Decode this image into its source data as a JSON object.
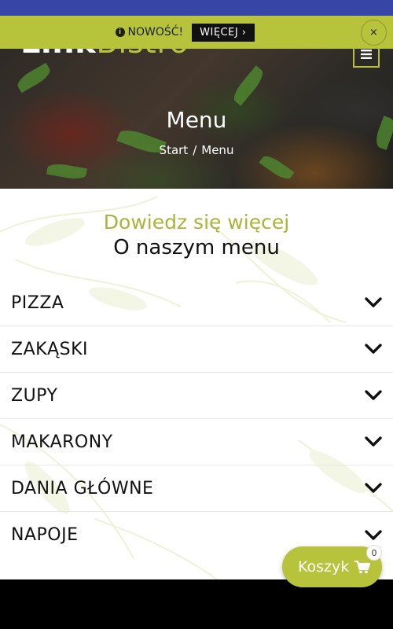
{
  "notice": {
    "text": "NOWOŚĆ!",
    "button_label": "WIĘCEJ ›",
    "close_label": "×"
  },
  "header": {
    "logo_part1": "Link",
    "logo_part2": "Bistro",
    "menu_icon": "hamburger-icon"
  },
  "hero": {
    "title": "Menu",
    "breadcrumb": {
      "home": "Start",
      "separator": "/",
      "current": "Menu"
    }
  },
  "main": {
    "eyebrow": "Dowiedz się więcej",
    "title": "O naszym menu",
    "categories": [
      {
        "label": "PIZZA"
      },
      {
        "label": "ZAKĄSKI"
      },
      {
        "label": "ZUPY"
      },
      {
        "label": "MAKARONY"
      },
      {
        "label": "DANIA GŁÓWNE"
      },
      {
        "label": "NAPOJE"
      }
    ]
  },
  "cart": {
    "label": "Koszyk",
    "count": "0",
    "icon": "cart-icon"
  },
  "colors": {
    "accent": "#b6c33b",
    "status_bar": "#3645a6",
    "text": "#111111"
  }
}
